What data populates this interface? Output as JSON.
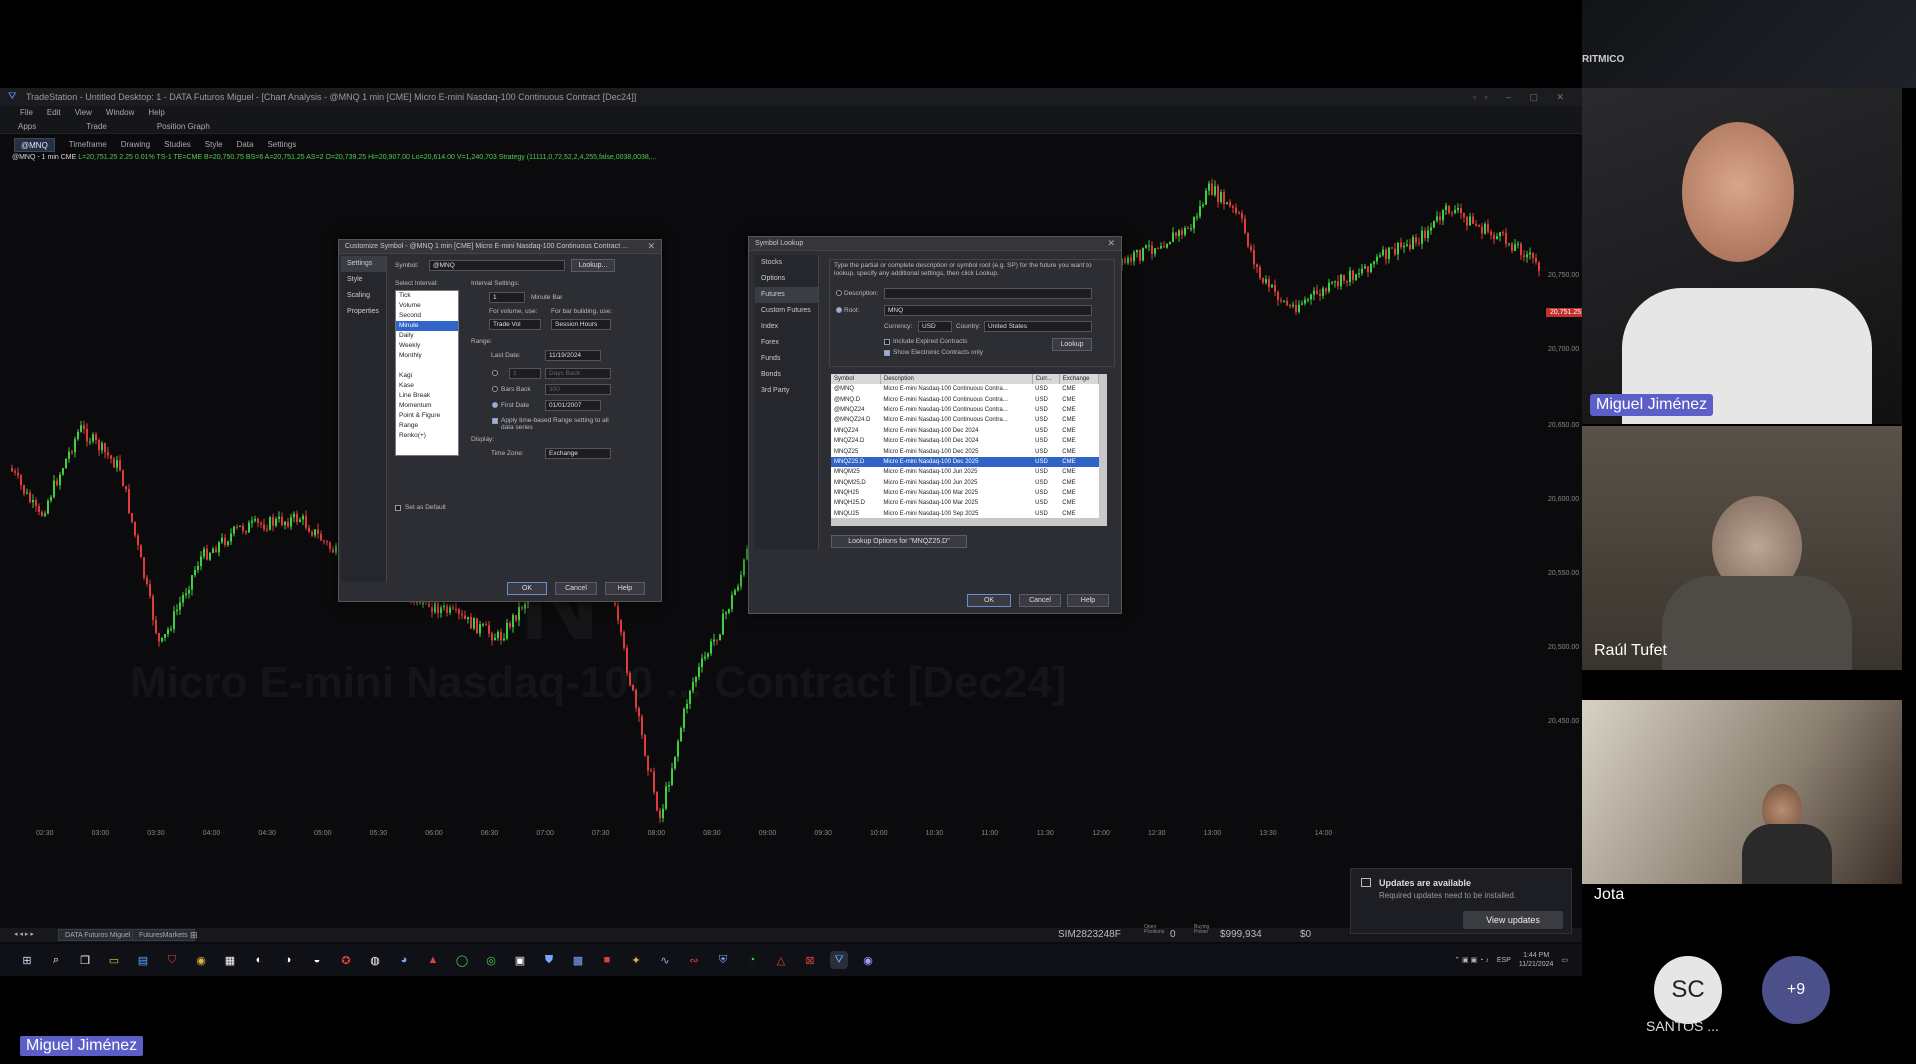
{
  "platform": {
    "window_title": "TradeStation - Untitled Desktop: 1 - DATA Futuros Miguel - [Chart Analysis - @MNQ 1 min [CME] Micro E-mini Nasdaq-100 Continuous Contract [Dec24]]"
  },
  "menu": [
    "File",
    "Edit",
    "View",
    "Window",
    "Help"
  ],
  "apps_bar": [
    "Apps",
    "Trade",
    "Position Graph"
  ],
  "toolbar": {
    "symbol": "@MNQ",
    "items": [
      "Timeframe",
      "Drawing",
      "Studies",
      "Style",
      "Data",
      "Settings"
    ]
  },
  "quote_line": {
    "symbol": "@MNQ - 1 min CME",
    "text": "L=20,751.25  2.25  0.01%  TS-1  TE=CME  B=20,750.75  BS=6  A=20,751.25  AS=2  O=20,739.25  Hi=20,907.00  Lo=20,614.00  V=1,240,703  Strategy (11111,0,72,52,2,4,255,false,0038,0038,..."
  },
  "watermark": {
    "symbol_fragment": "N",
    "contract_fragment": "Micro E-mini Nasdaq-100 ... Contract [Dec24]"
  },
  "chart": {
    "last_price": "20,751.25",
    "price_axis": [
      "20,750.00",
      "20,700.00",
      "20,650.00",
      "20,600.00",
      "20,550.00",
      "20,500.00",
      "20,450.00"
    ],
    "time_axis": [
      "02:30",
      "03:00",
      "03:30",
      "04:00",
      "04:30",
      "05:00",
      "05:30",
      "06:00",
      "06:30",
      "07:00",
      "07:30",
      "08:00",
      "08:30",
      "09:00",
      "09:30",
      "10:00",
      "10:30",
      "11:00",
      "11:30",
      "12:00",
      "12:30",
      "13:00",
      "13:30",
      "14:00"
    ]
  },
  "customize_dialog": {
    "title": "Customize Symbol - @MNQ 1 min [CME] Micro E-mini Nasdaq-100 Continuous Contract ...",
    "tabs": [
      "Settings",
      "Style",
      "Scaling",
      "Properties"
    ],
    "symbol_label": "Symbol:",
    "symbol_value": "@MNQ",
    "lookup_btn": "Lookup...",
    "select_interval_label": "Select Interval:",
    "intervals": [
      "Tick",
      "Volume",
      "Second",
      "Minute",
      "Daily",
      "Weekly",
      "Monthly",
      "",
      "Kagi",
      "Kase",
      "Line Break",
      "Momentum",
      "Point & Figure",
      "Range",
      "Renko(+)"
    ],
    "interval_settings_label": "Interval Settings:",
    "interval_value": "1",
    "interval_unit": "Minute Bar",
    "for_volume_label": "For volume, use:",
    "for_volume_value": "Trade Vol",
    "for_bar_label": "For bar building, use:",
    "for_bar_value": "Session Hours",
    "range_label": "Range:",
    "last_date_label": "Last Date:",
    "last_date_value": "11/19/2024",
    "blank_count": "1",
    "days_back": "Days Back",
    "bars_back_label": "Bars Back",
    "bars_back_value": "300",
    "first_date_label": "First Date",
    "first_date_value": "01/01/2007",
    "apply_label": "Apply time-based Range setting to all data series",
    "display_label": "Display:",
    "timezone_label": "Time Zone:",
    "timezone_value": "Exchange",
    "default_label": "Set as Default",
    "ok": "OK",
    "cancel": "Cancel",
    "help": "Help"
  },
  "lookup_dialog": {
    "title": "Symbol Lookup",
    "categories": [
      "Stocks",
      "Options",
      "Futures",
      "Custom Futures",
      "Index",
      "Forex",
      "Funds",
      "Bonds",
      "3rd Party"
    ],
    "instructions": "Type the partial or complete description or symbol root (e.g. SP) for the future you want to lookup, specify any additional settings, then click Lookup.",
    "description_label": "Description:",
    "root_label": "Root:",
    "root_value": "MNQ",
    "currency_label": "Currency:",
    "currency_value": "USD",
    "country_label": "Country:",
    "country_value": "United States",
    "lookup_btn": "Lookup",
    "include_expired": "Include Expired Contracts",
    "show_electronic": "Show Electronic Contracts only",
    "columns": [
      "Symbol",
      "Description",
      "Curr...",
      "Exchange"
    ],
    "rows": [
      [
        "@MNQ",
        "Micro E-mini Nasdaq-100 Continuous Contra...",
        "USD",
        "CME"
      ],
      [
        "@MNQ.D",
        "Micro E-mini Nasdaq-100 Continuous Contra...",
        "USD",
        "CME"
      ],
      [
        "@MNQZ24",
        "Micro E-mini Nasdaq-100 Continuous Contra...",
        "USD",
        "CME"
      ],
      [
        "@MNQZ24.D",
        "Micro E-mini Nasdaq-100 Continuous Contra...",
        "USD",
        "CME"
      ],
      [
        "MNQZ24",
        "Micro E-mini Nasdaq-100 Dec 2024",
        "USD",
        "CME"
      ],
      [
        "MNQZ24.D",
        "Micro E-mini Nasdaq-100 Dec 2024",
        "USD",
        "CME"
      ],
      [
        "MNQZ25",
        "Micro E-mini Nasdaq-100 Dec 2025",
        "USD",
        "CME"
      ],
      [
        "MNQZ25.D",
        "Micro E-mini Nasdaq-100 Dec 2025",
        "USD",
        "CME"
      ],
      [
        "MNQM25",
        "Micro E-mini Nasdaq-100 Jun 2025",
        "USD",
        "CME"
      ],
      [
        "MNQM25.D",
        "Micro E-mini Nasdaq-100 Jun 2025",
        "USD",
        "CME"
      ],
      [
        "MNQH25",
        "Micro E-mini Nasdaq-100 Mar 2025",
        "USD",
        "CME"
      ],
      [
        "MNQH25.D",
        "Micro E-mini Nasdaq-100 Mar 2025",
        "USD",
        "CME"
      ],
      [
        "MNQU25",
        "Micro E-mini Nasdaq-100 Sep 2025",
        "USD",
        "CME"
      ]
    ],
    "selected_row": 7,
    "options_btn": "Lookup Options for \"MNQZ25.D\"",
    "ok": "OK",
    "cancel": "Cancel",
    "help": "Help"
  },
  "bottom_tabs": [
    "DATA Futuros Miguel",
    "FuturesMarkets"
  ],
  "account": {
    "id": "SIM2823248F",
    "open_positions_label": "Open Positions",
    "open_positions": "0",
    "buying_power_label": "Buying Power",
    "buying_power": "$999,934",
    "pl": "$0"
  },
  "tray": {
    "lang": "ESP",
    "time": "1:44 PM",
    "date": "11/21/2024"
  },
  "meeting": {
    "top_label": "RITMICO",
    "participants": [
      {
        "name": "Miguel Jiménez"
      },
      {
        "name": "Raúl Tufet"
      },
      {
        "name": "Jota"
      }
    ],
    "avatar_initials": "SC",
    "avatar_name": "SANTOS ...",
    "more_count": "+9",
    "presenter": "Miguel Jiménez"
  },
  "notification": {
    "title": "Updates are available",
    "subtitle": "Required updates need to be installed.",
    "button": "View updates"
  },
  "colors": {
    "up": "#3fcf3f",
    "down": "#e03b3b",
    "accent": "#5b5fc7"
  }
}
